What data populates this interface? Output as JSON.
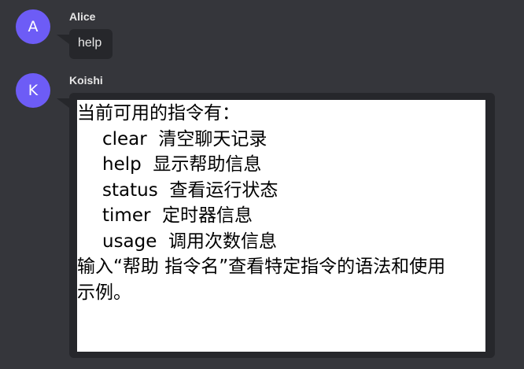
{
  "messages": [
    {
      "author": "Alice",
      "avatar_letter": "A",
      "text": "help"
    },
    {
      "author": "Koishi",
      "avatar_letter": "K",
      "reply": {
        "intro": "当前可用的指令有：",
        "commands": [
          {
            "name": "clear",
            "desc": "清空聊天记录"
          },
          {
            "name": "help",
            "desc": "显示帮助信息"
          },
          {
            "name": "status",
            "desc": "查看运行状态"
          },
          {
            "name": "timer",
            "desc": "定时器信息"
          },
          {
            "name": "usage",
            "desc": "调用次数信息"
          }
        ],
        "footer_line1": "输入“帮助 指令名”查看特定指令的语法和使用",
        "footer_line2": "示例。"
      }
    }
  ],
  "colors": {
    "background": "#35363b",
    "bubble": "#26272b",
    "avatar": "#6d5cf6",
    "author": "#e6e6e6",
    "card": "#ffffff"
  }
}
